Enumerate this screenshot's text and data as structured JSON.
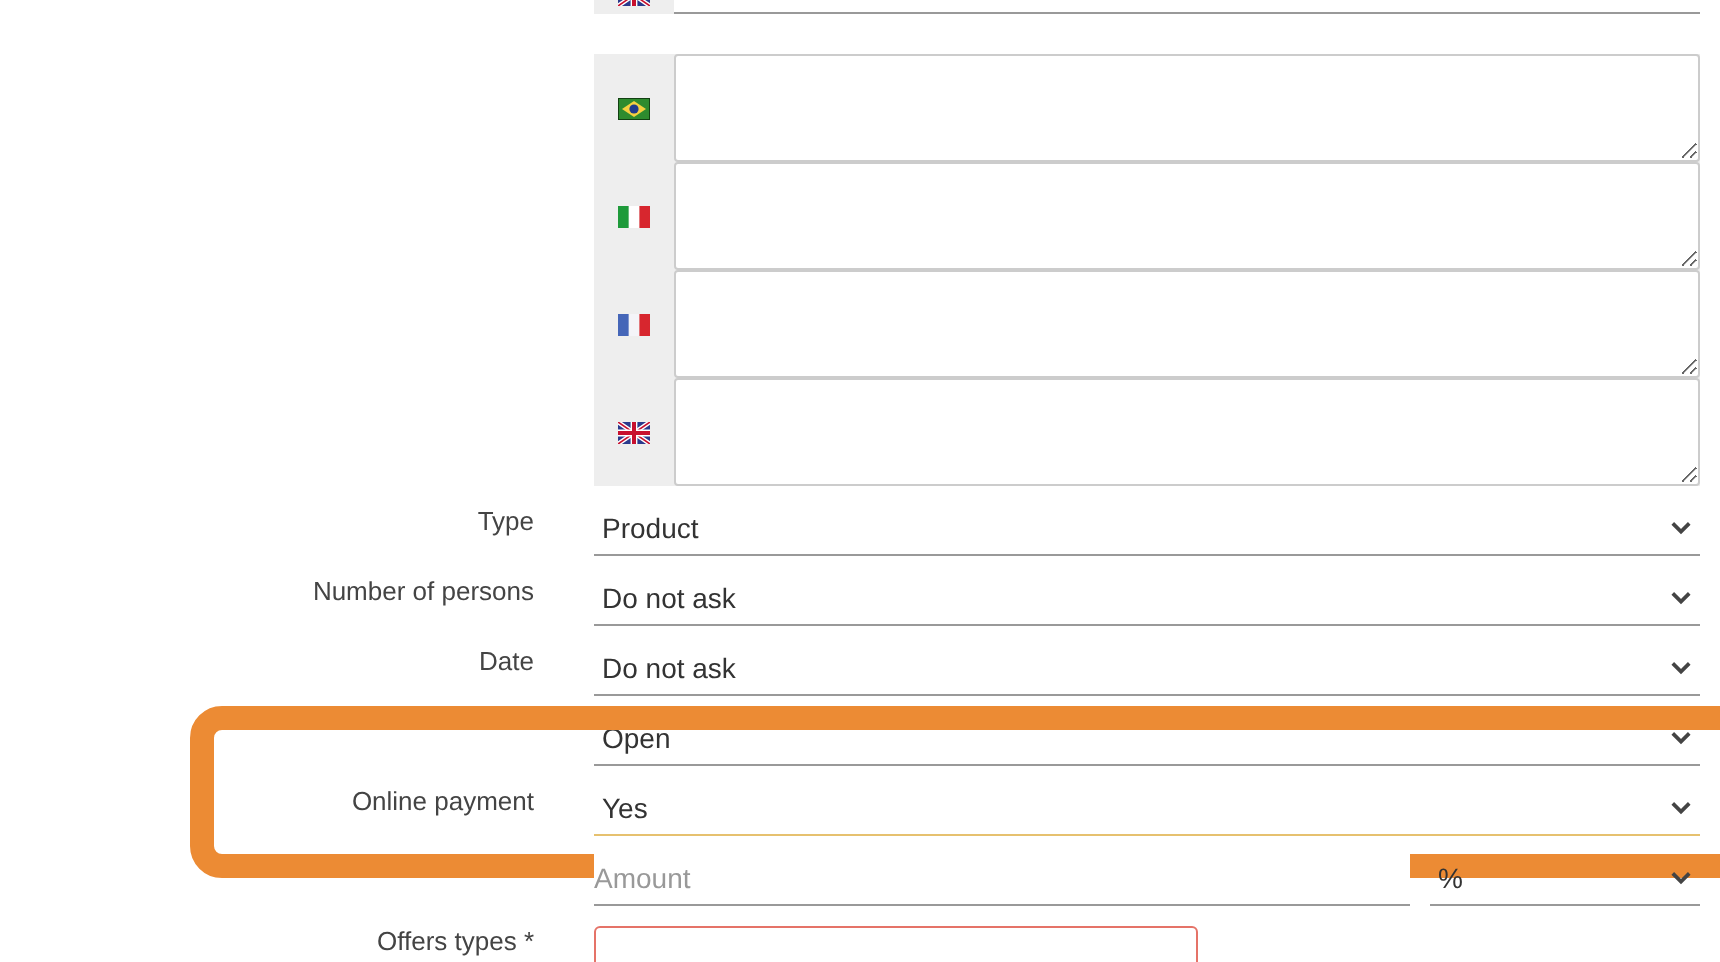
{
  "top_translation": {
    "kind": "gb"
  },
  "translations": [
    {
      "kind": "br"
    },
    {
      "kind": "it"
    },
    {
      "kind": "fr"
    },
    {
      "kind": "gb"
    }
  ],
  "rows": [
    {
      "kind": "select",
      "label": "Type",
      "value": "Product",
      "focused": false,
      "highlighted": false
    },
    {
      "kind": "select",
      "label": "Number of persons",
      "value": "Do not ask",
      "focused": false,
      "highlighted": false
    },
    {
      "kind": "select",
      "label": "Date",
      "value": "Do not ask",
      "focused": false,
      "highlighted": false
    },
    {
      "kind": "select",
      "value": "Open",
      "focused": false,
      "highlighted": false
    },
    {
      "kind": "select",
      "label": "Online payment",
      "value": "Yes",
      "focused": true,
      "highlighted": true
    },
    {
      "kind": "amount",
      "placeholder": "Amount",
      "unit": "%"
    },
    {
      "kind": "multi",
      "label": "Offers types *",
      "invalid": true
    }
  ]
}
